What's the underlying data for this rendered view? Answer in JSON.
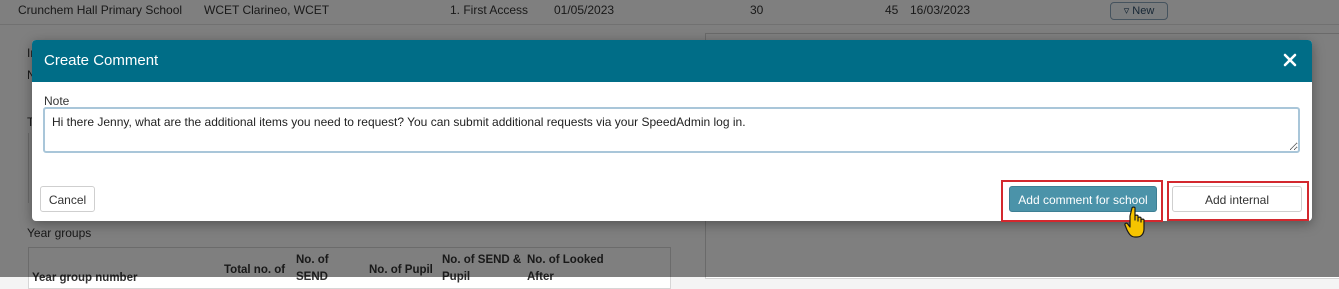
{
  "background": {
    "row": {
      "school": "Crunchem Hall Primary School",
      "contact": "WCET Clarineo, WCET",
      "stage": "1. First Access",
      "date1": "01/05/2023",
      "num1": "30",
      "num2": "45",
      "date2": "16/03/2023",
      "status_badge": "▿ New"
    },
    "fragments": [
      "In",
      "N",
      "T"
    ],
    "year_groups_label": "Year groups",
    "table_headers": [
      "Year group number",
      "Total no. of",
      "No. of SEND",
      "No. of Pupil",
      "No. of SEND & Pupil",
      "No. of Looked After"
    ]
  },
  "modal": {
    "title": "Create Comment",
    "note_label": "Note",
    "note_value": "Hi there Jenny, what are the additional items you need to request? You can submit additional requests via your SpeedAdmin log in.",
    "cancel_label": "Cancel",
    "school_comment_label": "Add comment for school",
    "internal_comment_label": "Add internal comment"
  },
  "colors": {
    "header": "#006d87",
    "primary_button": "#4b93a9",
    "highlight": "#d3282e"
  },
  "icons": {
    "close": "close-icon",
    "cursor": "hand-pointer-icon"
  }
}
